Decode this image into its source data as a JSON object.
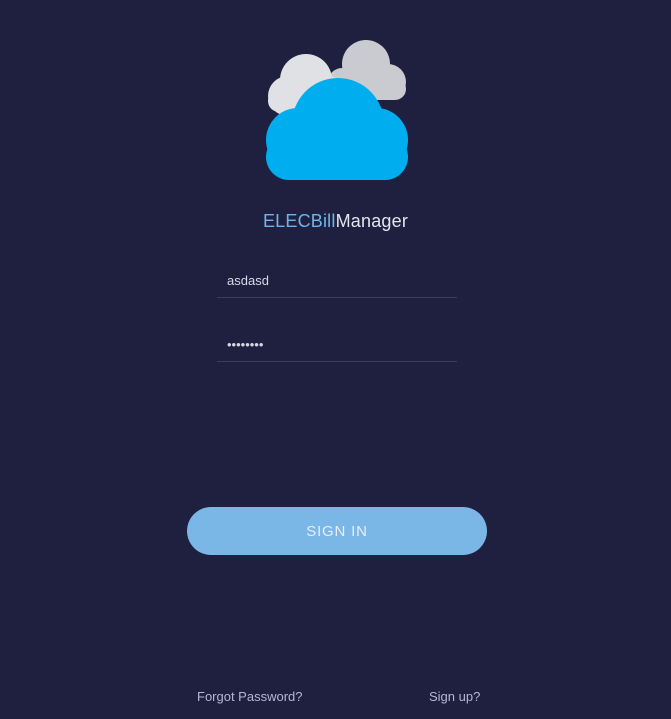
{
  "app": {
    "title_accent": "ELECBill",
    "title_rest": "Manager"
  },
  "form": {
    "username_value": "asdasd",
    "password_value": "asdasdas"
  },
  "actions": {
    "signin_label": "SIGN IN",
    "forgot_label": "Forgot Password?",
    "signup_label": "Sign up?"
  },
  "colors": {
    "background": "#1f2040",
    "accent": "#6fb3ea",
    "button": "#7ab6e6",
    "cloud_primary": "#00aeef",
    "cloud_secondary": "#c9cbd1",
    "cloud_tertiary": "#dfe1e5"
  },
  "icons": {
    "logo": "cloud-logo-icon"
  }
}
